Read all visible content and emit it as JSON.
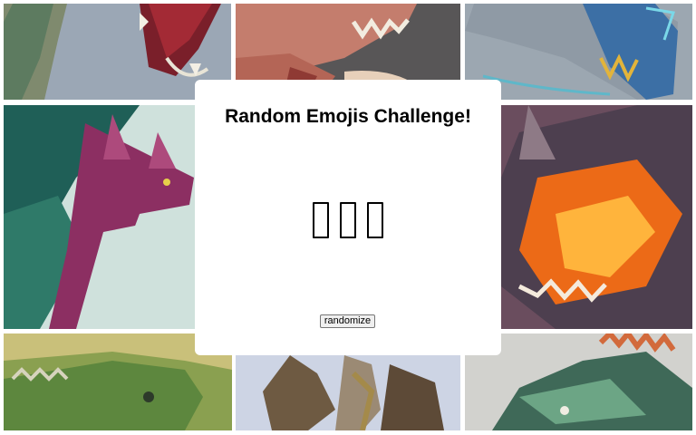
{
  "page": {
    "title": "Random Emojis Challenge!",
    "button_label": "randomize"
  },
  "emojis": [
    {
      "glyph": "",
      "icon": "missing-glyph-box"
    },
    {
      "glyph": "",
      "icon": "missing-glyph-box"
    },
    {
      "glyph": "",
      "icon": "missing-glyph-box"
    }
  ],
  "gallery": [
    {
      "subject": "dragon-open-jaw",
      "palette": [
        "#9ba7b5",
        "#5d7b60",
        "#a32a35"
      ]
    },
    {
      "subject": "dinosaur-teeth",
      "palette": [
        "#585657",
        "#c47d6d",
        "#e7d0ba"
      ]
    },
    {
      "subject": "blue-serpent",
      "palette": [
        "#9ca7b1",
        "#3c6fa5",
        "#e2b43b"
      ]
    },
    {
      "subject": "feathered-creature",
      "palette": [
        "#1f5f57",
        "#8c2f62",
        "#cfe1dc"
      ]
    },
    {
      "subject": "lava-dragon",
      "palette": [
        "#6a4d5e",
        "#ec6a17",
        "#ffb43c"
      ]
    },
    {
      "subject": "green-lizard",
      "palette": [
        "#8aa050",
        "#5d873e",
        "#c9c07a"
      ]
    },
    {
      "subject": "horned-beast",
      "palette": [
        "#cdd4e4",
        "#6e5a42",
        "#9b8a74"
      ]
    },
    {
      "subject": "crested-reptile",
      "palette": [
        "#3f6958",
        "#6ca585",
        "#d26a3c"
      ]
    }
  ]
}
